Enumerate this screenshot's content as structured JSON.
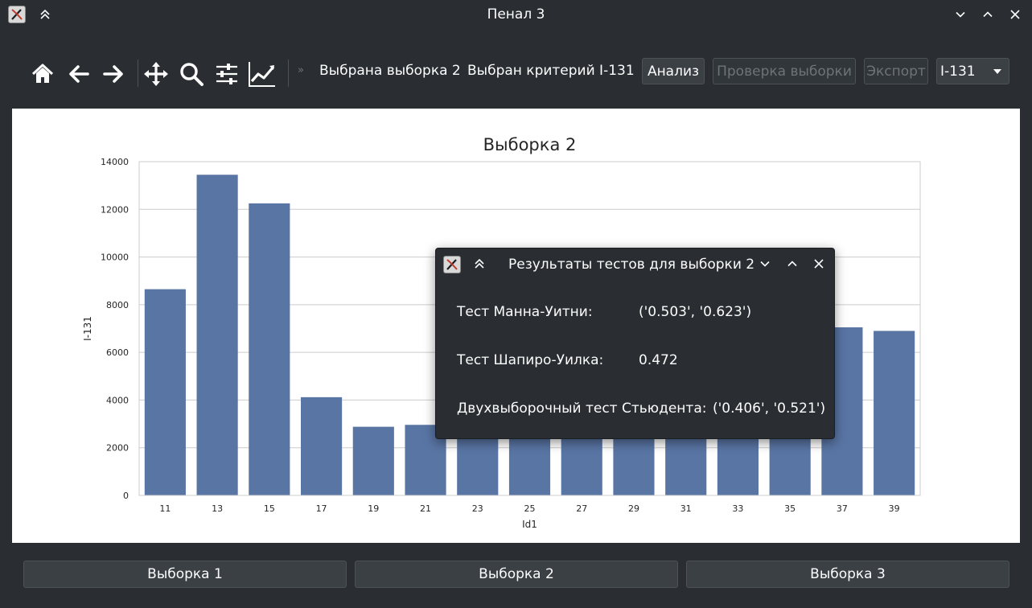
{
  "window": {
    "title": "Пенал 3"
  },
  "toolbar": {
    "tools": [
      "home-icon",
      "back-arrow-icon",
      "forward-arrow-icon",
      "pan-move-icon",
      "zoom-magnifier-icon",
      "configure-subplots-icon",
      "edit-axis-icon"
    ],
    "overflow_glyph": "»",
    "status_sample": "Выбрана выборка 2",
    "status_criterion": "Выбран критерий I-131",
    "analyze_label": "Анализ",
    "check_sample_label": "Проверка выборки",
    "export_label": "Экспорт",
    "criterion_select_value": "I-131"
  },
  "sample_buttons": [
    "Выборка 1",
    "Выборка 2",
    "Выборка 3"
  ],
  "chart_data": {
    "type": "bar",
    "title": "Выборка 2",
    "xlabel": "Id1",
    "ylabel": "I-131",
    "categories": [
      "11",
      "13",
      "15",
      "17",
      "19",
      "21",
      "23",
      "25",
      "27",
      "29",
      "31",
      "33",
      "35",
      "37",
      "39"
    ],
    "values": [
      8650,
      13450,
      12250,
      4120,
      2880,
      2960,
      3300,
      3500,
      3800,
      4000,
      4200,
      4500,
      5000,
      7050,
      6900
    ],
    "ylim": [
      0,
      14000
    ],
    "yticks": [
      0,
      2000,
      4000,
      6000,
      8000,
      10000,
      12000,
      14000
    ],
    "grid": true,
    "bar_color": "#5975a4"
  },
  "dialog": {
    "title": "Результаты тестов для выборки 2",
    "rows": [
      {
        "label": "Тест Манна-Уитни:",
        "value": "('0.503', '0.623')"
      },
      {
        "label": "Тест Шапиро-Уилка:",
        "value": "0.472"
      },
      {
        "label": "Двухвыборочный тест Стьюдента:",
        "value": "('0.406', '0.521')"
      }
    ]
  }
}
